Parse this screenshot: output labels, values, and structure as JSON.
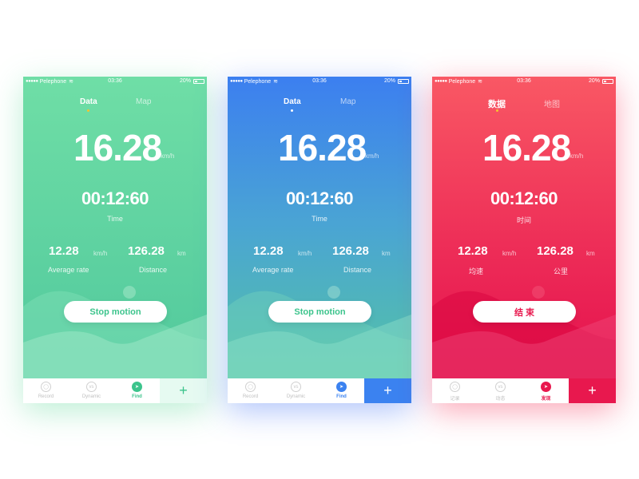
{
  "status_bar": {
    "signal": "●●●●●",
    "carrier": "Pelephone",
    "time": "03:36",
    "battery": "20%"
  },
  "screens": [
    {
      "theme": "green",
      "tabs": [
        "Data",
        "Map"
      ],
      "speed": "16.28",
      "speed_unit": "km/h",
      "timer": "00:12:60",
      "timer_label": "Time",
      "avg_rate": "12.28",
      "avg_rate_unit": "km/h",
      "avg_rate_label": "Average rate",
      "distance": "126.28",
      "distance_unit": "km",
      "distance_label": "Distance",
      "action_label": "Stop motion",
      "nav": [
        "Record",
        "Dynamic",
        "Find"
      ],
      "add_label": "+",
      "colors": {
        "accent": "#3cc48c",
        "add_bg": "#e6faf1",
        "mountain_a": "#8de4c0",
        "mountain_b": "#a7eacd"
      }
    },
    {
      "theme": "blue",
      "tabs": [
        "Data",
        "Map"
      ],
      "speed": "16.28",
      "speed_unit": "km/h",
      "timer": "00:12:60",
      "timer_label": "Time",
      "avg_rate": "12.28",
      "avg_rate_unit": "km/h",
      "avg_rate_label": "Average rate",
      "distance": "126.28",
      "distance_unit": "km",
      "distance_label": "Distance",
      "action_label": "Stop motion",
      "nav": [
        "Record",
        "Dynamic",
        "Find"
      ],
      "add_label": "+",
      "colors": {
        "accent": "#3b82f0",
        "add_bg": "#3b82f0",
        "mountain_a": "#7ad9bd",
        "mountain_b": "#8fe0c9"
      }
    },
    {
      "theme": "red",
      "tabs": [
        "数据",
        "地图"
      ],
      "speed": "16.28",
      "speed_unit": "km/h",
      "timer": "00:12:60",
      "timer_label": "时间",
      "avg_rate": "12.28",
      "avg_rate_unit": "km/h",
      "avg_rate_label": "均速",
      "distance": "126.28",
      "distance_unit": "km",
      "distance_label": "公里",
      "action_label": "结 束",
      "nav": [
        "记录",
        "动态",
        "发现"
      ],
      "add_label": "+",
      "colors": {
        "accent": "#e8184e",
        "add_bg": "#e8184e",
        "mountain_a": "#d9063f",
        "mountain_b": "#f04a7a"
      }
    }
  ]
}
